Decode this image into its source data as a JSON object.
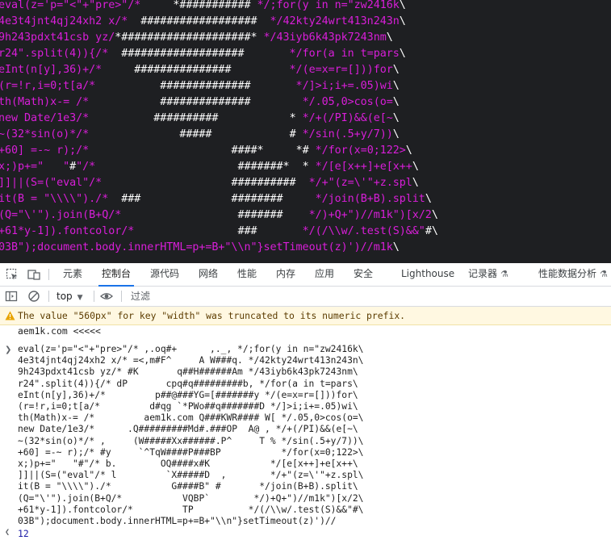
{
  "art_lines": [
    "eval(z='p=\"<\"+\"pre>\"/*     *########### */;for(y in n=\"zw2416k\\",
    "4e3t4jnt4qj24xh2 x/*  ##################  */42kty24wrt413n243n\\",
    "9h243pdxt41csb yz/*####################* */43iyb6k43pk7243nm\\",
    "r24\".split(4)){/*  ###################       */for(a in t=pars\\",
    "eInt(n[y],36)+/*     ###############         */(e=x=r=[]))for\\",
    "(r=!r,i=0;t[a/*          ##############       */]>i;i+=.05)wi\\",
    "th(Math)x-= /*           ##############        */.05,0>cos(o=\\",
    "new Date/1e3/*          ##########           * */+(/PI)&&(e[~\\",
    "~(32*sin(o)*/*              #####            # */sin(.5+y/7))\\",
    "+60] =-~ r);/*                      ####*     *# */for(x=0;122>\\",
    "x;)p+=\"   \"#\"/*                      #######*  * */[e[x++]+e[x++\\",
    "]]||(S=(\"eval\"/*                    ##########  */+\"(z=\\'\"+z.spl\\",
    "it(B = \"\\\\\\\\\")./*  ###              ########     */join(B+B).split\\",
    "(Q=\"\\'\").join(B+Q/*                  #######    */)+Q+\")//m1k\")[x/2\\",
    "+61*y-1]).fontcolor/*                ###       */(/\\\\w/.test(S)&&\"#\\",
    "03B\");document.body.innerHTML=p+=B+\"\\\\n\"}setTimeout(z)')//m1k\\"
  ],
  "tabs": [
    "元素",
    "控制台",
    "源代码",
    "网络",
    "性能",
    "内存",
    "应用",
    "安全",
    "Lighthouse",
    "记录器",
    "性能数据分析"
  ],
  "active_tab": "控制台",
  "context_select": "top",
  "filter_placeholder": "过滤",
  "warning_text": "The value \"560px\" for key \"width\" was truncated to its numeric prefix.",
  "log_message": "aem1k.com <<<<<",
  "input_lines": [
    "eval(z='p=\"<\"+\"pre>\"/* ,.oq#+      ,._, */;for(y in n=\"zw2416k\\",
    "4e3t4jnt4qj24xh2 x/* =<,m#F^     A W###q. */42kty24wrt413n243n\\",
    "9h243pdxt41csb yz/* #K       q##H######Am */43iyb6k43pk7243nm\\",
    "r24\".split(4)){/* dP       cpq#q#########b, */for(a in t=pars\\",
    "eInt(n[y],36)+/*         p##@###YG=[#######y */(e=x=r=[]))for\\",
    "(r=!r,i=0;t[a/*         d#qg `*PWo##q#######D */]>i;i+=.05)wi\\",
    "th(Math)x-= /*         aem1k.com Q###KWR#### W[ */.05,0>cos(o=\\",
    "new Date/1e3/*      .Q#########Md#.###OP  A@ , */+(/PI)&&(e[~\\",
    "~(32*sin(o)*/* ,     (W#####Xx######.P^     T % */sin(.5+y/7))\\",
    "+60] =-~ r);/* #y     `^TqW####P###BP           */for(x=0;122>\\",
    "x;)p+=\"   \"#\"/* b.        OQ####x#K           */[e[x++]+e[x++\\",
    "]]||(S=(\"eval\"/* l         `X#####D  ,        */+\"(z=\\'\"+z.spl\\",
    "it(B = \"\\\\\\\\\")./*           G####B\" #       */join(B+B).split\\",
    "(Q=\"\\'\").join(B+Q/*           VQBP`        */)+Q+\")//m1k\")[x/2\\",
    "+61*y-1]).fontcolor/*         TP          */(/\\\\w/.test(S)&&\"#\\",
    "03B\");document.body.innerHTML=p+=B+\"\\\\n\"}setTimeout(z)')//"
  ],
  "result_value": "12",
  "colors": {
    "stage_bg": "#1e1f22",
    "code_magenta": "#d91ed9",
    "art_white": "#ffffff",
    "active_tab_underline": "#1a73e8",
    "warning_bg": "#fff8e1",
    "result_blue": "#1a1aa6"
  },
  "icons": [
    "inspect-element-icon",
    "device-toolbar-icon",
    "sidebar-toggle-icon",
    "clear-console-icon",
    "eye-icon",
    "warning-icon",
    "chevron-right-icon",
    "chevron-left-icon",
    "flask-icon",
    "dropdown-caret-icon"
  ]
}
